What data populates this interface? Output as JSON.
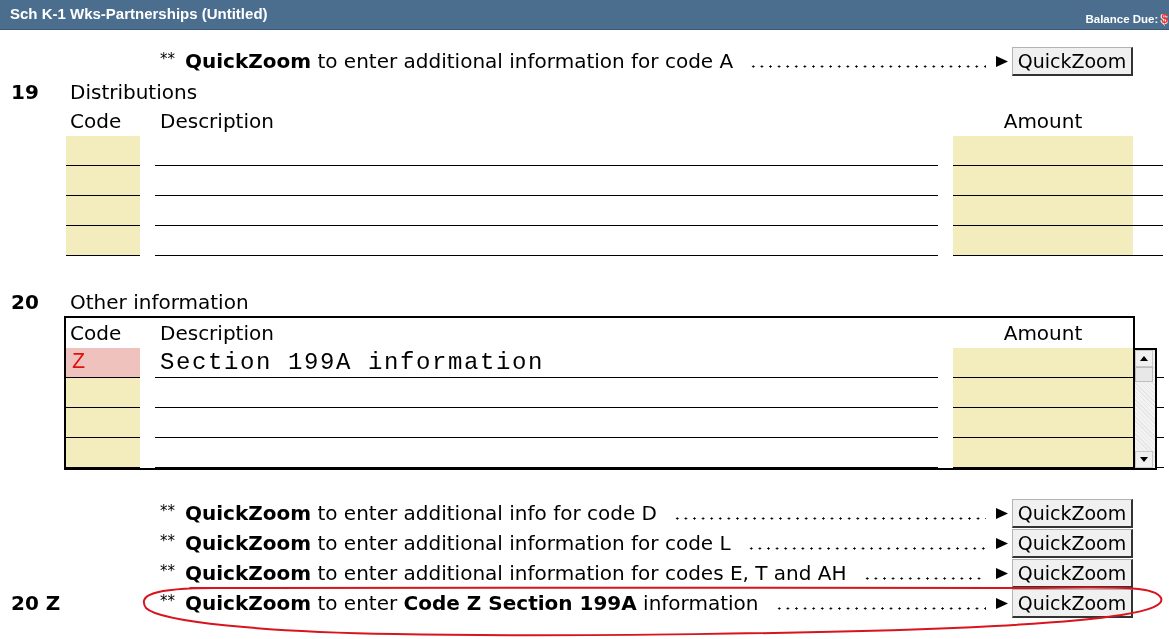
{
  "window": {
    "title": "Sch K-1 Wks-Partnerships (Untitled)",
    "balance_due_label": "Balance Due:",
    "balance_due_amount": "$"
  },
  "top_quickzoom": [
    {
      "marker": "**",
      "text": "**QuickZoom** to enter additional information for code A",
      "button": "QuickZoom",
      "circled": false
    }
  ],
  "line_19": {
    "number": "19",
    "title": "Distributions",
    "columns": [
      "Code",
      "Description",
      "Amount"
    ],
    "rows": [
      {
        "flagged": false
      },
      {
        "flagged": false
      },
      {
        "flagged": false
      },
      {
        "flagged": false
      }
    ]
  },
  "line_20": {
    "number": "20",
    "title": "Other information",
    "columns": [
      "Code",
      "Description",
      "Amount"
    ],
    "rows": [
      {
        "code": "Z",
        "description": "Section 199A information",
        "flagged": true
      },
      {
        "flagged": false
      },
      {
        "flagged": false
      },
      {
        "flagged": false
      }
    ]
  },
  "bottom_quickzoom": [
    {
      "marker": "**",
      "text": "**QuickZoom** to enter additional info for code D",
      "button": "QuickZoom",
      "circled": false
    },
    {
      "marker": "**",
      "text": "**QuickZoom** to enter additional information for code L",
      "button": "QuickZoom",
      "circled": false
    },
    {
      "marker": "**",
      "text": "**QuickZoom** to enter additional information for codes E, T and AH",
      "button": "QuickZoom",
      "circled": false
    },
    {
      "line_number": "20 Z",
      "marker": "**",
      "text": "**QuickZoom** to enter **Code Z Section 199A** information",
      "button": "QuickZoom",
      "circled": true
    }
  ]
}
